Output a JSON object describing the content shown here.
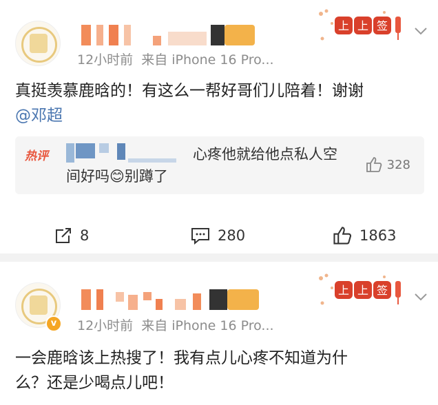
{
  "posts": [
    {
      "meta_time": "12小时前",
      "meta_source": "来自 iPhone 16 Pro...",
      "text": "真挺羡慕鹿晗的！有这么一帮好哥们儿陪着！谢谢",
      "mention": "@邓超",
      "hot_comment": {
        "tag": "热评",
        "text_a": "心疼他就给他点私人空",
        "text_b": "间好吗",
        "emoji": "😊",
        "text_c": "别蹲了",
        "likes": "328"
      },
      "actions": {
        "repost_count": "8",
        "comment_count": "280",
        "like_count": "1863"
      }
    },
    {
      "meta_time": "12小时前",
      "meta_source": "来自 iPhone 16 Pro...",
      "text_line1": "一会鹿晗该上热搜了！我有点儿心疼不知道为什",
      "text_line2": "么？还是少喝点儿吧！"
    }
  ],
  "decor": {
    "badge_chars": [
      "上",
      "上",
      "签"
    ],
    "verified_mark": "v",
    "accent_red": "#d9402b",
    "link_blue": "#4a76b0",
    "hot_red": "#e8573e"
  },
  "icons": [
    "repost-icon",
    "comment-icon",
    "like-icon",
    "chevron-down-icon"
  ]
}
